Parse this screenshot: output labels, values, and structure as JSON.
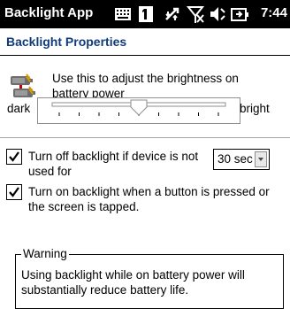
{
  "title_bar": {
    "app_title": "Backlight App",
    "time": "7:44",
    "tray_icons": [
      "keyboard-icon",
      "one-icon",
      "connectivity-icon",
      "no-signal-icon",
      "volume-icon",
      "battery-charging-icon"
    ]
  },
  "header": {
    "title": "Backlight Properties"
  },
  "intro": {
    "text": "Use this to adjust the brightness on battery power"
  },
  "slider": {
    "min_label": "dark",
    "max_label": "bright",
    "tick_count": 9,
    "level": 0.5
  },
  "options": [
    {
      "label": "Turn off backlight if device is not used for",
      "checked": true
    },
    {
      "label": "Turn on backlight when a button is pressed or the screen is tapped.",
      "checked": true
    }
  ],
  "timeout": {
    "value": "30 sec"
  },
  "warning": {
    "legend": "Warning",
    "text": "Using backlight while on battery power will substantially reduce battery life."
  },
  "colors": {
    "header_title": "#103b7a",
    "title_bar_bg": "#000000"
  }
}
